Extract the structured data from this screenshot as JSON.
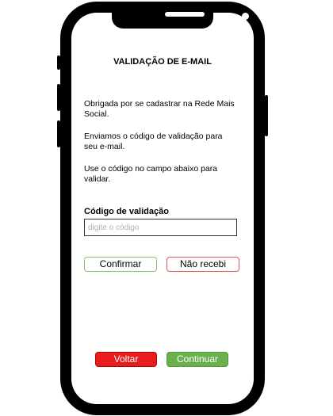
{
  "screen": {
    "title": "VALIDAÇÃO DE E-MAIL",
    "paragraphs": [
      "Obrigada por se cadastrar na Rede Mais Social.",
      "Enviamos o código de validação para seu e-mail.",
      "Use o código no campo abaixo para validar."
    ]
  },
  "form": {
    "code_label": "Código de validação",
    "code_placeholder": "digite o código",
    "code_value": ""
  },
  "buttons": {
    "confirm": "Confirmar",
    "not_received": "Não recebi",
    "back": "Voltar",
    "continue": "Continuar"
  },
  "colors": {
    "confirm_border": "#88c070",
    "not_received_border": "#e05555",
    "back_fill": "#e81d1d",
    "continue_fill": "#6ab04c"
  }
}
